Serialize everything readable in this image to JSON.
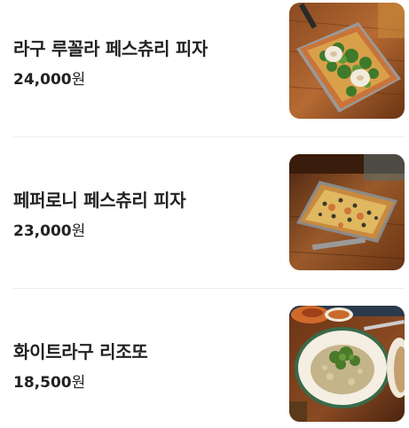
{
  "currency_suffix": "원",
  "menu_items": [
    {
      "name": "라구 루꼴라 페스츄리 피자",
      "price": "24,000",
      "image": "pizza-ragu-arugula-photo"
    },
    {
      "name": "페퍼로니 페스츄리 피자",
      "price": "23,000",
      "image": "pizza-pepperoni-photo"
    },
    {
      "name": "화이트라구 리조또",
      "price": "18,500",
      "image": "white-ragu-risotto-photo"
    }
  ],
  "colors": {
    "text": "#222222",
    "divider": "#eeeeee",
    "background": "#ffffff"
  }
}
